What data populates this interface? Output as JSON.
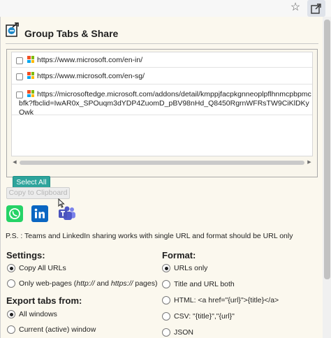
{
  "browser": {
    "star_icon": "star-outline-icon",
    "extension_icon": "group-tabs-extension-icon"
  },
  "header": {
    "title": "Group Tabs & Share"
  },
  "tabs": {
    "urls": [
      {
        "url": "https://www.microsoft.com/en-in/",
        "checked": false
      },
      {
        "url": "https://www.microsoft.com/en-sg/",
        "checked": false
      },
      {
        "url": "https://microsoftedge.microsoft.com/addons/detail/kmppjfacpkgnneoplpflhnmcpbpmcbfk?fbclid=IwAR0x_SPOuqm3dYDP4ZuomD_pBV98nHd_Q8450RgrnWFRsTW9CiKlDKyOwk",
        "checked": false
      }
    ],
    "select_all_label": "Select All"
  },
  "actions": {
    "copy_label": "Copy to Clipboard"
  },
  "share": {
    "icons": [
      "whatsapp-icon",
      "linkedin-icon",
      "teams-icon"
    ]
  },
  "note": "P.S. : Teams and LinkedIn sharing works with single URL and format should be URL only",
  "settings": {
    "title": "Settings:",
    "options": [
      {
        "label": "Copy All URLs",
        "selected": true
      },
      {
        "label_parts": [
          "Only web-pages (",
          "http://",
          " and ",
          "https://",
          " pages)"
        ],
        "selected": false
      }
    ]
  },
  "export": {
    "title": "Export tabs from:",
    "options": [
      {
        "label": "All windows",
        "selected": true
      },
      {
        "label": "Current (active) window",
        "selected": false
      }
    ]
  },
  "format": {
    "title": "Format:",
    "options": [
      {
        "label": "URLs only",
        "selected": true
      },
      {
        "label": "Title and URL both",
        "selected": false
      },
      {
        "label": "HTML: <a href=\"{url}\">{title}</a>",
        "selected": false
      },
      {
        "label": "CSV: \"{title}\",\"{url}\"",
        "selected": false
      },
      {
        "label": "JSON",
        "selected": false
      }
    ]
  },
  "colors": {
    "accent": "#2da49c",
    "panel_bg": "#fbf8ee"
  }
}
